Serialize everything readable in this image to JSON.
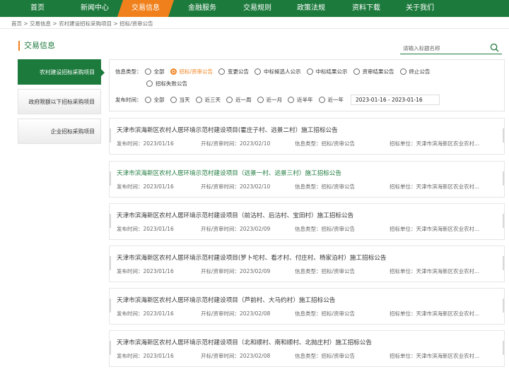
{
  "nav": {
    "items": [
      "首页",
      "新闻中心",
      "交易信息",
      "金融服务",
      "交易规则",
      "政策法规",
      "资料下载",
      "关于我们"
    ],
    "active_index": 2
  },
  "breadcrumb": "首页 > 交易信息 > 农村建设招标采购项目 > 招标/资审公告",
  "section_title": "交易信息",
  "search": {
    "placeholder": "请输入标题名称",
    "icon": "search-icon"
  },
  "sidebar": {
    "items": [
      {
        "label": "农村建设招标采购项目",
        "active": true
      },
      {
        "label": "政府限额以下招标采购项目",
        "active": false
      },
      {
        "label": "企业招标采购项目",
        "active": false
      }
    ]
  },
  "filter": {
    "type_label": "信息类型：",
    "type_options": [
      "全部",
      "招标/资审公告",
      "变更公告",
      "中标候选人公示",
      "中标结果公示",
      "资审结果公告",
      "终止公告",
      "招标失败公告"
    ],
    "type_selected": "招标/资审公告",
    "time_label": "发布时间：",
    "time_options": [
      "全部",
      "当天",
      "近三天",
      "近一周",
      "近一月",
      "近半年",
      "近一年"
    ],
    "date_range": "2023-01-16 - 2023-01-16"
  },
  "announcements": [
    {
      "title": "天津市滨海新区农村人居环境示范村建设项目(霍庄子村、远景二村）施工招标公告",
      "publish": "发布时间：2023/01/16",
      "open": "开标/资审时间：2023/02/10",
      "type": "信息类型：招标/资审公告",
      "unit": "招标单位：天津市滨海新区农业农村..."
    },
    {
      "title": "天津市滨海新区农村人居环境示范村建设项目（远景一村、远景三村）施工招标公告",
      "publish": "发布时间：2023/01/16",
      "open": "开标/资审时间：2023/02/10",
      "type": "信息类型：招标/资审公告",
      "unit": "招标单位：天津市滨海新区农业农村..."
    },
    {
      "title": "天津市滨海新区农村人居环境示范村建设项目（前沽村、后沽村、宝田村）施工招标公告",
      "publish": "发布时间：2023/01/16",
      "open": "开标/资审时间：2023/02/09",
      "type": "信息类型：招标/资审公告",
      "unit": "招标单位：天津市滨海新区农业农村..."
    },
    {
      "title": "天津市滨海新区农村人居环境示范村建设项目(罗卜坨村、看才村、付庄村、杨家泊村）施工招标公告",
      "publish": "发布时间：2023/01/16",
      "open": "开标/资审时间：2023/02/09",
      "type": "信息类型：招标/资审公告",
      "unit": "招标单位：天津市滨海新区农业农村..."
    },
    {
      "title": "天津市滨海新区农村人居环境示范村建设项目（芦前村、大马约村）施工招标公告",
      "publish": "发布时间：2023/01/16",
      "open": "开标/资审时间：2023/02/08",
      "type": "信息类型：招标/资审公告",
      "unit": "招标单位：天津市滨海新区农业农村..."
    },
    {
      "title": "天津市滨海新区农村人居环境示范村建设项目（北和顺村、南和顺村、北抛庄村）施工招标公告",
      "publish": "发布时间：2023/01/16",
      "open": "开标/资审时间：2023/02/08",
      "type": "信息类型：招标/资审公告",
      "unit": "招标单位：天津市滨海新区农业农村..."
    }
  ],
  "colors": {
    "brand_green": "#1c7a3c",
    "accent_orange": "#f0801b"
  }
}
